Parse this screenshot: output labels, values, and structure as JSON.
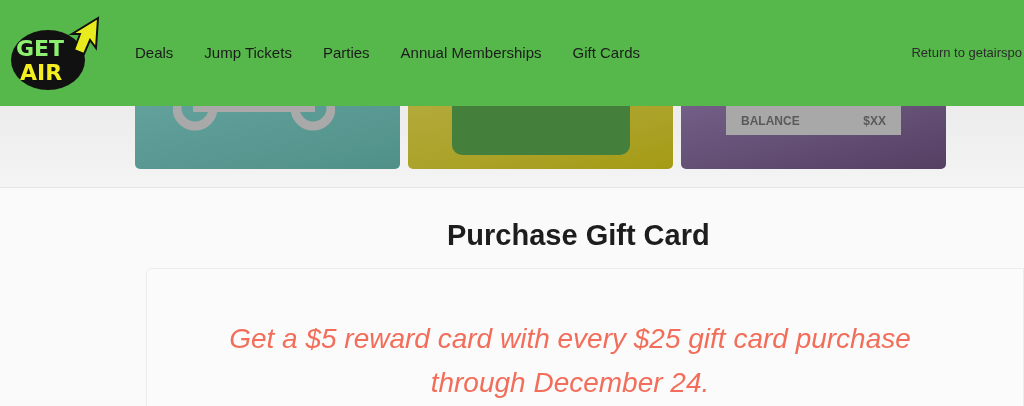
{
  "header": {
    "logo": {
      "line_1": "GET",
      "line_2": "AIR"
    },
    "nav": [
      {
        "label": "Deals"
      },
      {
        "label": "Jump Tickets"
      },
      {
        "label": "Parties"
      },
      {
        "label": "Annual Memberships"
      },
      {
        "label": "Gift Cards"
      }
    ],
    "return_link": "Return to getairspo"
  },
  "gift_cards": [
    {
      "kind": "teal"
    },
    {
      "kind": "yellow"
    },
    {
      "kind": "purple",
      "balance_label": "BALANCE",
      "balance_value": "$XX"
    }
  ],
  "title": "Purchase Gift Card",
  "promo": "Get a $5 reward card with every $25 gift card purchase through December 24."
}
